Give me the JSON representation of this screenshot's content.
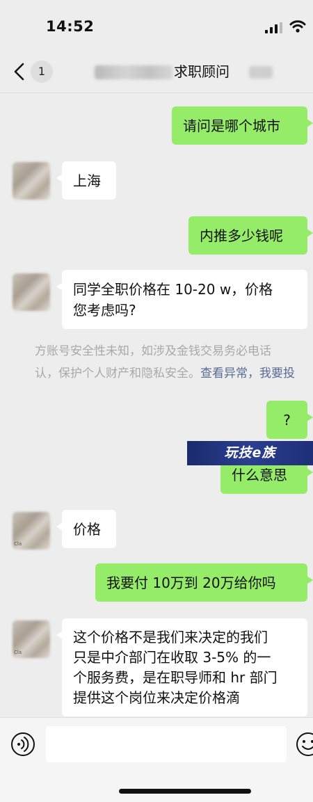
{
  "status_bar": {
    "time": "14:52"
  },
  "nav": {
    "unread_count": "1",
    "title": "求职顾问"
  },
  "messages": [
    {
      "side": "out",
      "text": "请问是哪个城市"
    },
    {
      "side": "in",
      "text": "上海"
    },
    {
      "side": "out",
      "text": "内推多少钱呢"
    },
    {
      "side": "in",
      "text_line1": "同学全职价格在 10-20 w，价格",
      "text_line2": "您考虑吗?"
    },
    {
      "side": "out",
      "text": "?"
    },
    {
      "side": "out",
      "text": "什么意思"
    },
    {
      "side": "in",
      "text": "价格"
    },
    {
      "side": "out",
      "text": "我要付 10万到 20万给你吗"
    },
    {
      "side": "in",
      "line1": "这个价格不是我们来决定的我们",
      "line2": "只是中介部门在收取 3-5% 的一",
      "line3": "个服务费，是在职导师和 hr 部门",
      "line4": "提供这个岗位来决定价格滴"
    }
  ],
  "avatar_labels": [
    "Cla",
    "Cla"
  ],
  "system_notice": {
    "line1": "方账号安全性未知，如涉及金钱交易务必电话",
    "line2_text": "认，保护个人财产和隐私安全。",
    "link_view": "查看异常",
    "line2_tail": "，我要投"
  },
  "watermark": "玩技e族",
  "input": {
    "placeholder": ""
  }
}
